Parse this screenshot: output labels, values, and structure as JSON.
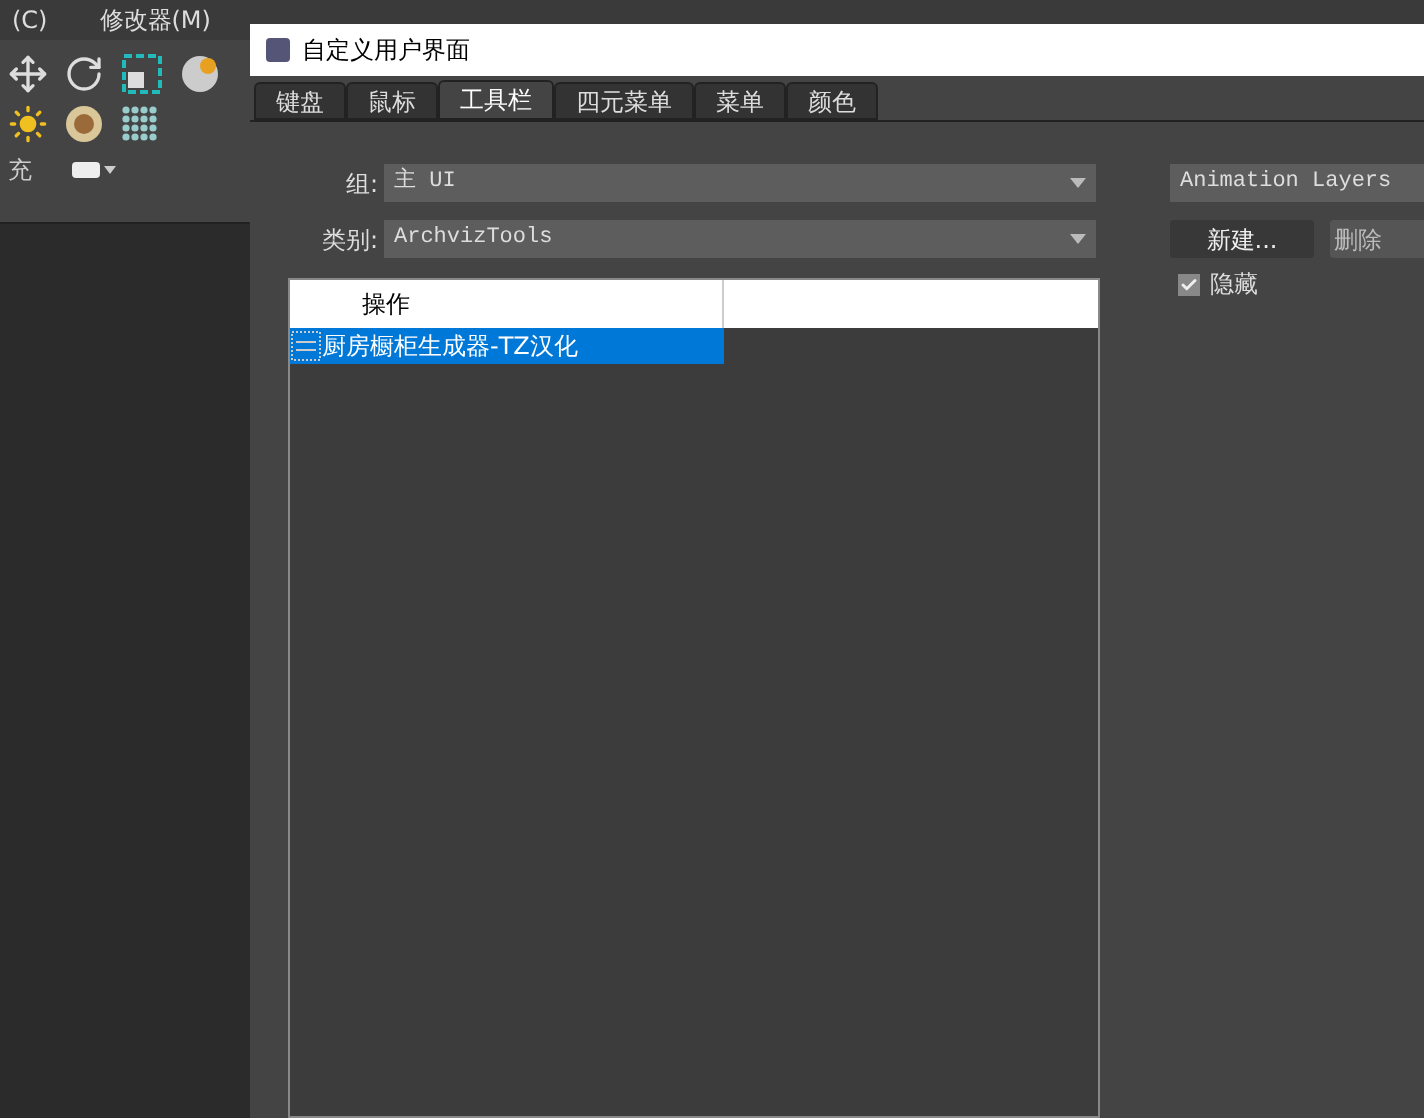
{
  "menu_bar": {
    "items": [
      "(C)",
      "修改器(M)"
    ]
  },
  "side_panel": {
    "label": "充"
  },
  "dialog": {
    "title": "自定义用户界面",
    "tabs": [
      {
        "label": "键盘",
        "selected": false
      },
      {
        "label": "鼠标",
        "selected": false
      },
      {
        "label": "工具栏",
        "selected": true
      },
      {
        "label": "四元菜单",
        "selected": false
      },
      {
        "label": "菜单",
        "selected": false
      },
      {
        "label": "颜色",
        "selected": false
      }
    ],
    "group": {
      "label": "组:",
      "value": "主 UI"
    },
    "category": {
      "label": "类别:",
      "value": "ArchvizTools"
    },
    "table": {
      "columns": [
        "操作"
      ],
      "rows": [
        {
          "name": "厨房橱柜生成器-TZ汉化",
          "selected": true
        }
      ]
    },
    "toolbar_select": {
      "value": "Animation Layers"
    },
    "buttons": [
      "新建...",
      "删除"
    ],
    "hidden_checkbox": {
      "label": "隐藏",
      "checked": true
    }
  }
}
